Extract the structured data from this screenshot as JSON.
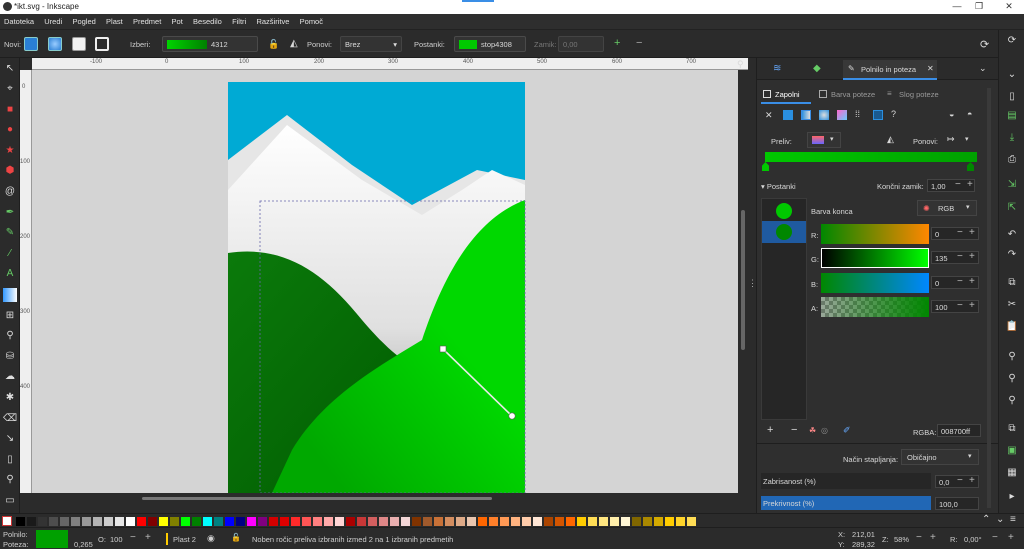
{
  "window": {
    "title": "*ikt.svg - Inkscape",
    "minimize": "—",
    "maximize": "❐",
    "close": "✕"
  },
  "menu": [
    "Datoteka",
    "Uredi",
    "Pogled",
    "Plast",
    "Predmet",
    "Pot",
    "Besedilo",
    "Filtri",
    "Razširitve",
    "Pomoč"
  ],
  "toolbar": {
    "new_label": "Novi:",
    "select_label": "Izberi:",
    "select_value": "4312",
    "repeat_label": "Ponovi:",
    "repeat_value": "Brez",
    "stops_label": "Postanki:",
    "stop_value": "stop4308",
    "offset_label": "Zamik:",
    "offset_value": "0,00",
    "accent": "#00c800"
  },
  "ruler": {
    "h_ticks": [
      "-100",
      "0",
      "100",
      "200",
      "300",
      "400",
      "500",
      "600",
      "700"
    ],
    "v_ticks": [
      "0",
      "100",
      "200",
      "300",
      "400"
    ]
  },
  "dock": {
    "tab_title": "Polnilo in poteza",
    "subtabs": {
      "fill": "Zapolni",
      "stroke_paint": "Barva poteze",
      "stroke_style": "Slog poteze"
    },
    "gradient_label": "Preliv:",
    "repeat_label": "Ponovi:",
    "stops_header": "Postanki",
    "end_offset_label": "Končni zamik:",
    "end_offset_value": "1,00",
    "stop_color_label": "Barva konca",
    "color_mode": "RGB",
    "channels": [
      {
        "name": "R:",
        "value": "0"
      },
      {
        "name": "G:",
        "value": "135"
      },
      {
        "name": "B:",
        "value": "0"
      },
      {
        "name": "A:",
        "value": "100"
      }
    ],
    "rgba_label": "RGBA:",
    "rgba_value": "008700ff",
    "blend_label": "Način stapljanja:",
    "blend_value": "Običajno",
    "blur_label": "Zabrisanost (%)",
    "blur_value": "0,0",
    "opacity_label": "Prekrivnost (%)",
    "opacity_value": "100,0"
  },
  "status": {
    "fill_label": "Polnilo:",
    "stroke_label": "Poteza:",
    "stroke_width": "0,265",
    "opacity_label": "O:",
    "opacity_value": "100",
    "layer": "Plast 2",
    "message": "Noben ročic preliva izbranih izmed 2 na 1 izbranih predmetih",
    "x_label": "X:",
    "x_value": "212,01",
    "y_label": "Y:",
    "y_value": "289,32",
    "zoom_label": "Z:",
    "zoom_value": "58%",
    "rot_label": "R:",
    "rot_value": "0,00°"
  },
  "palette": [
    "#000000",
    "#1a1a1a",
    "#333333",
    "#4d4d4d",
    "#666666",
    "#808080",
    "#999999",
    "#b3b3b3",
    "#cccccc",
    "#e6e6e6",
    "#ffffff",
    "#ff0000",
    "#800000",
    "#ffff00",
    "#808000",
    "#00ff00",
    "#008000",
    "#00ffff",
    "#008080",
    "#0000ff",
    "#000080",
    "#ff00ff",
    "#800080",
    "#d40000",
    "#e00000",
    "#ff2a2a",
    "#ff5555",
    "#ff8080",
    "#ffaaaa",
    "#ffd5d5",
    "#aa0000",
    "#c83737",
    "#d35f5f",
    "#de8787",
    "#e9afaf",
    "#f4d7d7",
    "#803300",
    "#a05a2c",
    "#c87137",
    "#d38d5f",
    "#deaa87",
    "#e9c6af",
    "#ff6600",
    "#ff7f2a",
    "#ff9955",
    "#ffb380",
    "#ffccaa",
    "#ffe6d5",
    "#aa4400",
    "#d45500",
    "#ff6600",
    "#ffcc00",
    "#ffdd55",
    "#ffe680",
    "#ffeeaa",
    "#fff6d5",
    "#806600",
    "#aa8800",
    "#d4aa00",
    "#ffcc00",
    "#ffd42a",
    "#ffdd55"
  ],
  "colors": {
    "sky": "#00aad4",
    "snow": "#ffffff",
    "green_bright": "#00d400",
    "green_dark": "#008000"
  }
}
